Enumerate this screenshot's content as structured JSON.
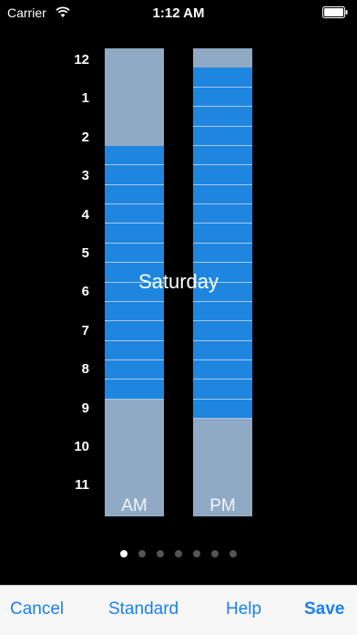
{
  "status_bar": {
    "carrier": "Carrier",
    "time": "1:12 AM",
    "wifi_icon": "wifi-icon",
    "battery_icon": "battery-icon"
  },
  "schedule": {
    "day": "Saturday",
    "hours": [
      "12",
      "1",
      "2",
      "3",
      "4",
      "5",
      "6",
      "7",
      "8",
      "9",
      "10",
      "11"
    ],
    "am_label": "AM",
    "pm_label": "PM",
    "slots_per_column": 24,
    "am_active": [
      5,
      6,
      7,
      8,
      9,
      10,
      11,
      12,
      13,
      14,
      15,
      16,
      17
    ],
    "pm_active": [
      1,
      2,
      3,
      4,
      5,
      6,
      7,
      8,
      9,
      10,
      11,
      12,
      13,
      14,
      15,
      16,
      17,
      18
    ],
    "colors": {
      "active": "#1f86df",
      "inactive": "#90aac6"
    }
  },
  "pagination": {
    "pages": 7,
    "current": 1
  },
  "toolbar": {
    "cancel_label": "Cancel",
    "standard_label": "Standard",
    "help_label": "Help",
    "save_label": "Save",
    "accent": "#1a80f0"
  }
}
